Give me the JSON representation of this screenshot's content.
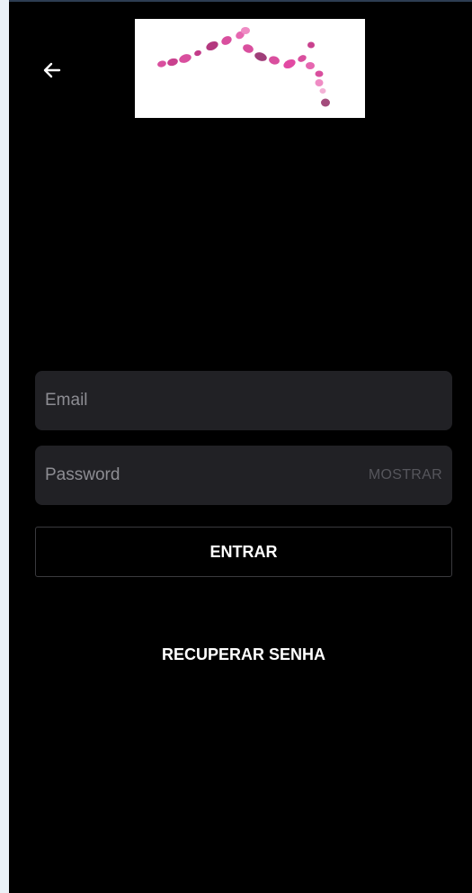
{
  "header": {
    "back_icon": "arrow-left-icon",
    "logo_icon": "pink-dots-logo"
  },
  "login_form": {
    "email_placeholder": "Email",
    "email_value": "",
    "password_placeholder": "Password",
    "password_value": "",
    "show_password_label": "MOSTRAR",
    "submit_label": "ENTRAR"
  },
  "recover_password_label": "RECUPERAR SENHA",
  "colors": {
    "background": "#000000",
    "field_background": "#212125",
    "logo_accent": "#d94f9e",
    "text": "#ffffff"
  }
}
